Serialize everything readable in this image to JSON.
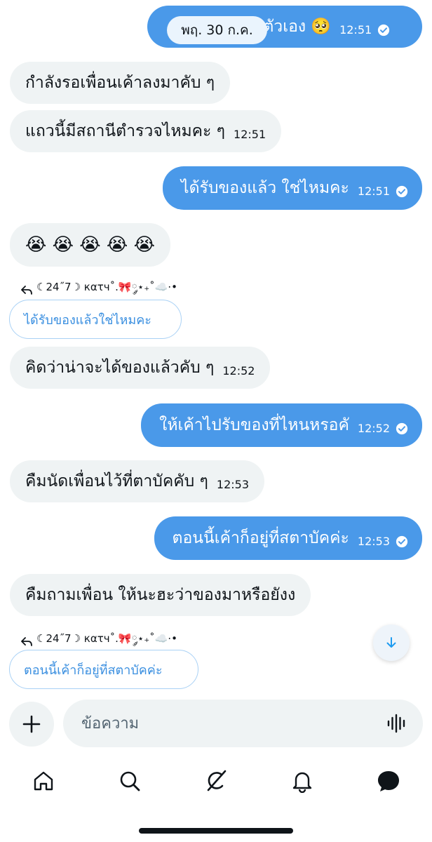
{
  "date_separator": "พฤ. 30 ก.ค.",
  "messages": [
    {
      "text": "…ะตัวเอง 🥺",
      "time": "12:51"
    },
    {
      "text": "กำลังรอเพื่อนเค้าลงมาคับ ๆ"
    },
    {
      "text": "แถวนี้มีสถานีตำรวจไหมคะ ๆ",
      "time": "12:51"
    },
    {
      "text": "ได้รับของแล้ว ใช่ไหมคะ",
      "time": "12:51"
    },
    {
      "text": "😭 😭 😭 😭 😭"
    },
    {
      "text": "คิดว่าน่าจะได้ของแล้วคับ ๆ",
      "time": "12:52"
    },
    {
      "text": "ให้เค้าไปรับของที่ไหนหรอคั",
      "time": "12:52"
    },
    {
      "text": "คืมนัดเพื่อนไว้ที่ตาบัคคับ ๆ",
      "time": "12:53"
    },
    {
      "text": "ตอนนี้เค้าก็อยู่ที่สตาบัคค่ะ",
      "time": "12:53"
    },
    {
      "text": "คืมถามเพื่อน ให้นะฮะว่าของมาหรือยังง"
    }
  ],
  "replies": [
    {
      "sender": "☾24˝7☽ кατч˚.🎀༘⋆₊˚☁️⋅•",
      "quote": "ได้รับของแล้วใช่ไหมคะ"
    },
    {
      "sender": "☾24˝7☽ кατч˚.🎀༘⋆₊˚☁️⋅•",
      "quote": "ตอนนี้เค้าก็อยู่ที่สตาบัคค่ะ"
    }
  ],
  "composer": {
    "placeholder": "ข้อความ"
  },
  "icons": {
    "check": "check-circle-icon",
    "reply": "reply-arrow-icon",
    "scroll_down": "arrow-down-icon",
    "add": "plus-icon",
    "voice": "voice-wave-icon",
    "tabs": [
      "home-icon",
      "search-icon",
      "grok-icon",
      "bell-icon",
      "messages-icon"
    ]
  },
  "colors": {
    "outgoing": "#4a99e9",
    "incoming": "#eff3f4",
    "accent": "#1d9bf0"
  }
}
